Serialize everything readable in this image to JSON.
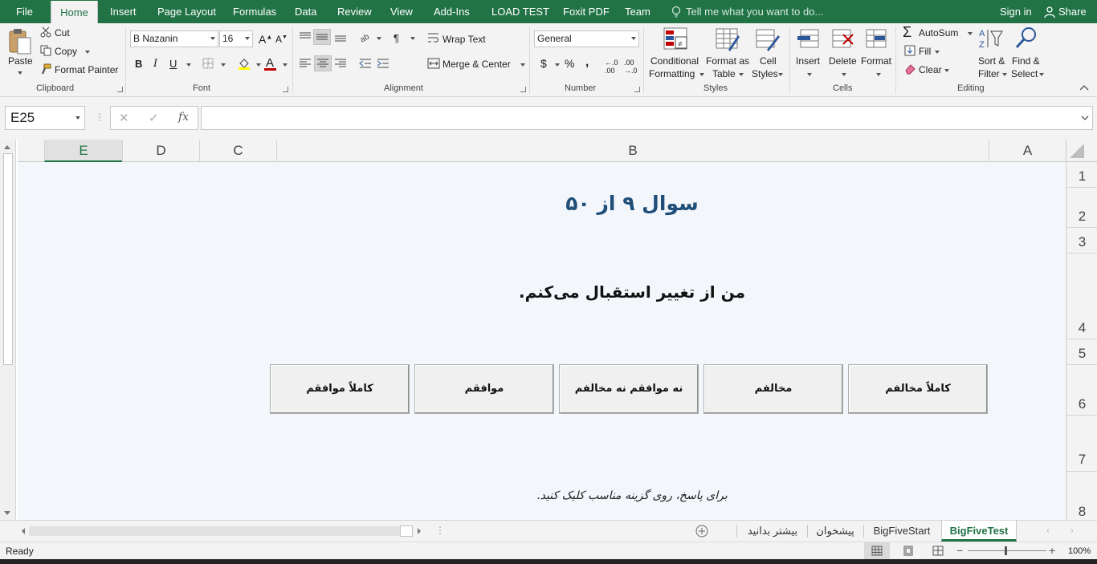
{
  "menu": {
    "file": "File",
    "tabs": [
      "Home",
      "Insert",
      "Page Layout",
      "Formulas",
      "Data",
      "Review",
      "View",
      "Add-Ins",
      "LOAD TEST",
      "Foxit PDF",
      "Team"
    ],
    "tell_me": "Tell me what you want to do...",
    "sign_in": "Sign in",
    "share": "Share"
  },
  "ribbon": {
    "clipboard": {
      "paste": "Paste",
      "cut": "Cut",
      "copy": "Copy",
      "format_painter": "Format Painter",
      "label": "Clipboard"
    },
    "font": {
      "name": "B Nazanin",
      "size": "16",
      "bold": "B",
      "italic": "I",
      "underline": "U",
      "label": "Font"
    },
    "alignment": {
      "wrap_text": "Wrap Text",
      "merge_center": "Merge & Center",
      "label": "Alignment"
    },
    "number": {
      "format": "General",
      "currency": "$",
      "percent": "%",
      "comma": ",",
      "label": "Number"
    },
    "styles": {
      "conditional_1": "Conditional",
      "conditional_2": "Formatting",
      "format_table_1": "Format as",
      "format_table_2": "Table",
      "cell_styles_1": "Cell",
      "cell_styles_2": "Styles",
      "label": "Styles"
    },
    "cells": {
      "insert": "Insert",
      "delete": "Delete",
      "format": "Format",
      "label": "Cells"
    },
    "editing": {
      "autosum": "AutoSum",
      "fill": "Fill",
      "clear": "Clear",
      "sort_1": "Sort &",
      "sort_2": "Filter",
      "find_1": "Find &",
      "find_2": "Select",
      "label": "Editing"
    }
  },
  "formula_bar": {
    "name_box": "E25",
    "fx": "fx",
    "value": ""
  },
  "columns": [
    "E",
    "D",
    "C",
    "B",
    "A"
  ],
  "rows": [
    "1",
    "2",
    "3",
    "4",
    "5",
    "6",
    "7",
    "8"
  ],
  "content": {
    "question_title": "سوال ۹ از ۵۰",
    "question_text": "من از تغییر استقبال می‌کنم.",
    "answers": [
      "کاملاً مخالفم",
      "مخالفم",
      "نه موافقم نه مخالفم",
      "موافقم",
      "کاملاً موافقم"
    ],
    "hint": "برای پاسخ، روی گزینه مناسب کلیک کنید."
  },
  "sheet_tabs": [
    "BigFiveTest",
    "BigFiveStart",
    "پیشخوان",
    "بیشتر بدانید"
  ],
  "active_sheet": "BigFiveTest",
  "status": {
    "ready": "Ready",
    "zoom": "100%"
  },
  "colors": {
    "excel_green": "#217346",
    "title_blue": "#1f4e79",
    "sheet_bg": "#f3f7fc"
  }
}
